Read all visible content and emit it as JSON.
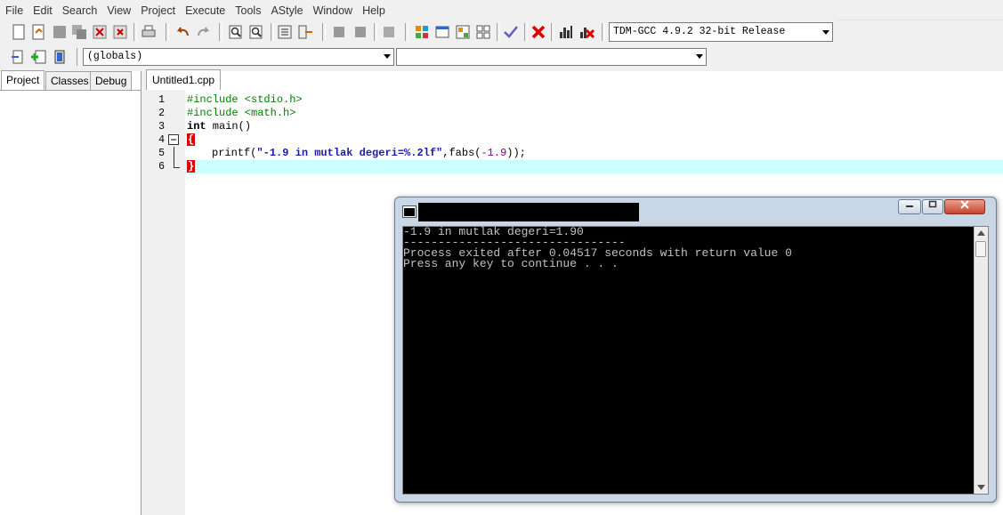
{
  "menu": [
    "File",
    "Edit",
    "Search",
    "View",
    "Project",
    "Execute",
    "Tools",
    "AStyle",
    "Window",
    "Help"
  ],
  "compiler": "TDM-GCC 4.9.2 32-bit Release",
  "scope": "(globals)",
  "scope2": "",
  "tabs": [
    "Project",
    "Classes",
    "Debug"
  ],
  "file_tab": "Untitled1.cpp",
  "code": [
    {
      "n": "1",
      "pre": "#include <stdio.h>"
    },
    {
      "n": "2",
      "pre": "#include <math.h>"
    },
    {
      "n": "3",
      "kw": "int",
      "rest": " main()"
    },
    {
      "n": "4",
      "brace": "{"
    },
    {
      "n": "5",
      "fn": "printf(",
      "str": "\"-1.9 in mutlak degeri=%.2lf\"",
      "mid": ",fabs(",
      "num": "-1.9",
      "end": "));"
    },
    {
      "n": "6",
      "brace": "}"
    }
  ],
  "console": {
    "line1": "-1.9 in mutlak degeri=1.90",
    "line2": "--------------------------------",
    "line3": "Process exited after 0.04517 seconds with return value 0",
    "line4": "Press any key to continue . . ."
  },
  "colors": {
    "active_line": "#ccffff",
    "brace_highlight": "#e00000"
  }
}
